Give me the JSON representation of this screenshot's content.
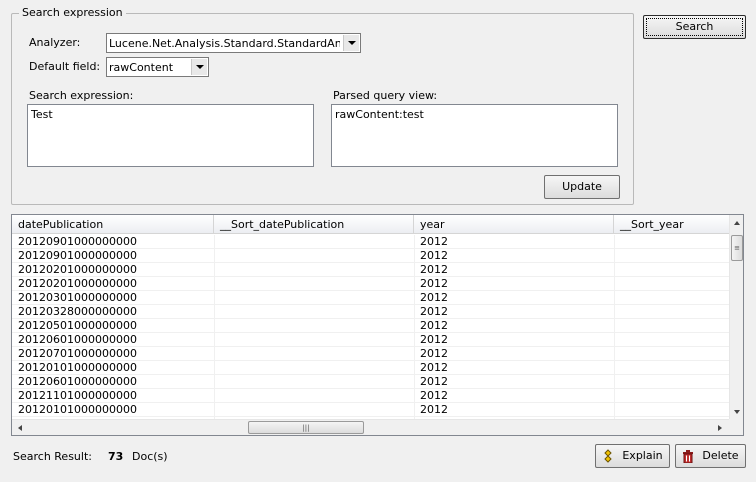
{
  "search_group": {
    "title": "Search expression",
    "analyzer_label": "Analyzer:",
    "analyzer_value": "Lucene.Net.Analysis.Standard.StandardAnalyzer",
    "default_field_label": "Default field:",
    "default_field_value": "rawContent",
    "search_expression_label": "Search expression:",
    "search_expression_value": "Test",
    "parsed_query_label": "Parsed query view:",
    "parsed_query_value": "rawContent:test",
    "update_label": "Update"
  },
  "search_button_label": "Search",
  "grid": {
    "columns": [
      "datePublication",
      "__Sort_datePublication",
      "year",
      "__Sort_year"
    ],
    "rows": [
      [
        "20120901000000000",
        "",
        "2012",
        ""
      ],
      [
        "20120901000000000",
        "",
        "2012",
        ""
      ],
      [
        "20120201000000000",
        "",
        "2012",
        ""
      ],
      [
        "20120201000000000",
        "",
        "2012",
        ""
      ],
      [
        "20120301000000000",
        "",
        "2012",
        ""
      ],
      [
        "20120328000000000",
        "",
        "2012",
        ""
      ],
      [
        "20120501000000000",
        "",
        "2012",
        ""
      ],
      [
        "20120601000000000",
        "",
        "2012",
        ""
      ],
      [
        "20120701000000000",
        "",
        "2012",
        ""
      ],
      [
        "20120101000000000",
        "",
        "2012",
        ""
      ],
      [
        "20120601000000000",
        "",
        "2012",
        ""
      ],
      [
        "20121101000000000",
        "",
        "2012",
        ""
      ],
      [
        "20120101000000000",
        "",
        "2012",
        ""
      ]
    ]
  },
  "footer": {
    "result_label": "Search Result:",
    "result_count": "73",
    "result_unit": "Doc(s)",
    "explain_label": "Explain",
    "delete_label": "Delete"
  },
  "icons": {
    "dropdown": "chevron-down-icon",
    "explain": "explain-icon",
    "delete": "trash-icon"
  }
}
